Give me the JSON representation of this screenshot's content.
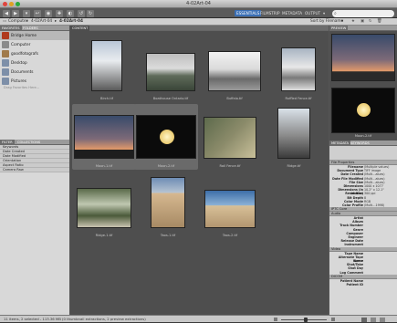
{
  "window": {
    "title": "4-02Art-04"
  },
  "toolbar": {
    "workspaces": [
      "ESSENTIALS",
      "FILMSTRIP",
      "METADATA",
      "OUTPUT"
    ],
    "sort": "Sort by Filename"
  },
  "path": {
    "items": [
      "Computer",
      "4-02Art-04",
      "4-02Art-04"
    ]
  },
  "left": {
    "tabs": [
      "FAVORITES",
      "FOLDERS"
    ],
    "favorites": [
      {
        "label": "Bridge Home",
        "icon": "bridge-icon",
        "color": "#b03a1e"
      },
      {
        "label": "Computer",
        "icon": "computer-icon",
        "color": "#8a8a8a"
      },
      {
        "label": "goodfotografs",
        "icon": "home-icon",
        "color": "#a07a4a"
      },
      {
        "label": "Desktop",
        "icon": "desktop-icon",
        "color": "#7d8fa8"
      },
      {
        "label": "Documents",
        "icon": "documents-icon",
        "color": "#7d8fa8"
      },
      {
        "label": "Pictures",
        "icon": "pictures-icon",
        "color": "#7d8fa8"
      }
    ],
    "favorites_note": "Drag Favorites Here...",
    "filter_tabs": [
      "FILTER",
      "COLLECTIONS"
    ],
    "filters": [
      "Keywords",
      "Date Created",
      "Date Modified",
      "Orientation",
      "Aspect Ratio",
      "Camera Raw"
    ]
  },
  "content": {
    "tab": "CONTENT",
    "thumbnails": [
      {
        "label": "Birch.tif",
        "kind": "tree"
      },
      {
        "label": "Boathouse Ontario.tif",
        "kind": "landscape"
      },
      {
        "label": "Buffalo.tif",
        "kind": "wagon"
      },
      {
        "label": "Ruffled Fence.tif",
        "kind": "fence"
      },
      {
        "label": "Moon-1.tif",
        "kind": "sunset"
      },
      {
        "label": "Moon-2.tif",
        "kind": "moon"
      },
      {
        "label": "Rail Fence.tif",
        "kind": "wheel"
      },
      {
        "label": "Ridge.tif",
        "kind": "ridge"
      },
      {
        "label": "Ridge-1.tif",
        "kind": "trees"
      },
      {
        "label": "Taos-1.tif",
        "kind": "church"
      },
      {
        "label": "Taos-2.tif",
        "kind": "church2"
      }
    ]
  },
  "right": {
    "preview_tab": "PREVIEW",
    "preview_caption": "Moon-2.tif",
    "metadata_tabs": [
      "METADATA",
      "KEYWORDS"
    ],
    "file_properties_title": "File Properties",
    "file_properties": [
      {
        "k": "Filename",
        "v": "(Multiple values)"
      },
      {
        "k": "Document Type",
        "v": "TIFF image"
      },
      {
        "k": "Date Created",
        "v": "(Multi...alues)"
      },
      {
        "k": "Date File Modified",
        "v": "(Multi...alues)"
      },
      {
        "k": "File Size",
        "v": "(Multi...alues)"
      },
      {
        "k": "Dimensions",
        "v": "1000 x 1077"
      },
      {
        "k": "Dimensions (in inches)",
        "v": "10.2\" x 12.1\""
      },
      {
        "k": "Resolution",
        "v": "300 ppi"
      },
      {
        "k": "Bit Depth",
        "v": "8"
      },
      {
        "k": "Color Mode",
        "v": "RGB"
      },
      {
        "k": "Color Profile",
        "v": "(Multi...1998)"
      }
    ],
    "iptc_title": "IPTC Core",
    "audio_title": "Audio",
    "audio": [
      "Artist",
      "Album",
      "Track Number",
      "Genre",
      "Composer",
      "Engineer",
      "Release Date",
      "Instrument"
    ],
    "video_title": "Video",
    "video": [
      "Tape Name",
      "Alternate Tape Name",
      "Scene",
      "Shot/Take",
      "Shot Day",
      "Log Comment"
    ],
    "dicom_title": "DICOM",
    "dicom": [
      "Patient Name",
      "Patient ID"
    ]
  },
  "status": {
    "text": "11 items, 2 selected - 113.36 MB (0 thumbnail extractions, 2 preview extractions)"
  }
}
